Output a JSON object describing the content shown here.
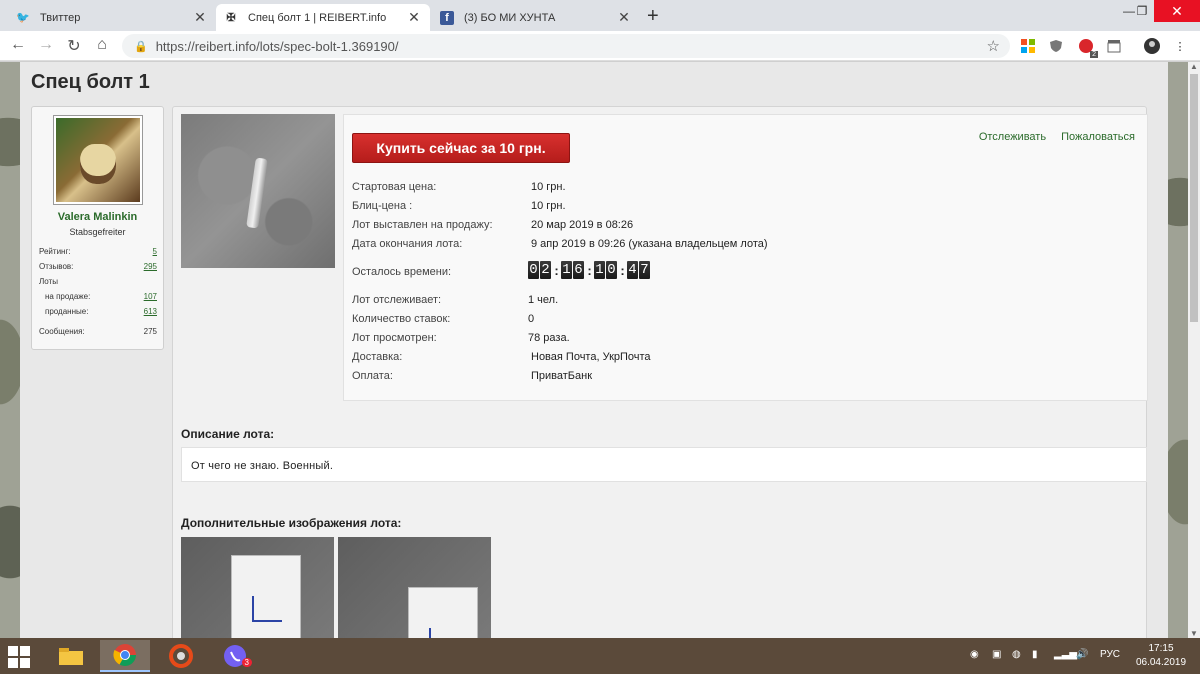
{
  "browser": {
    "tabs": [
      {
        "title": "Твиттер",
        "favicon": "twitter-icon",
        "color": "#1da1f2"
      },
      {
        "title": "Спец болт 1 | REIBERT.info",
        "favicon": "cross-icon",
        "active": true
      },
      {
        "title": "(3) БО МИ ХУНТА",
        "favicon": "facebook-icon",
        "color": "#3b5998"
      }
    ],
    "url": "https://reibert.info/lots/spec-bolt-1.369190/",
    "extension_badge": "2"
  },
  "page": {
    "title": "Спец болт 1"
  },
  "user": {
    "name": "Valera Malinkin",
    "rank": "Stabsgefreiter",
    "stats": [
      {
        "label": "Рейтинг:",
        "value": "5",
        "link": true
      },
      {
        "label": "Отзывов:",
        "value": "295",
        "link": true
      },
      {
        "label": "Лоты",
        "value": ""
      },
      {
        "label": "на продаже:",
        "value": "107",
        "link": true
      },
      {
        "label": "проданные:",
        "value": "613",
        "link": true
      },
      {
        "label": "Сообщения:",
        "value": "275",
        "link": false
      }
    ]
  },
  "lot": {
    "buy_label": "Купить сейчас за 10 грн.",
    "watch_label": "Отслеживать",
    "report_label": "Пожаловаться",
    "rows": [
      {
        "label": "Стартовая цена:",
        "value": "10 грн."
      },
      {
        "label": "Блиц-цена :",
        "value": "10 грн."
      },
      {
        "label": "Лот выставлен на продажу:",
        "value": "20 мар 2019 в 08:26"
      },
      {
        "label": "Дата окончания лота:",
        "value": "9 апр 2019 в 09:26 (указана владельцем лота)"
      }
    ],
    "time_left_label": "Осталось времени:",
    "time_left": {
      "d": "02",
      "h": "16",
      "m": "10",
      "s": "47"
    },
    "rows2": [
      {
        "label": "Лот отслеживает:",
        "value": "1 чел."
      },
      {
        "label": "Количество ставок:",
        "value": "0"
      },
      {
        "label": "Лот просмотрен:",
        "value": "78 раза."
      },
      {
        "label": "Доставка:",
        "value": "Новая Почта, УкрПочта"
      },
      {
        "label": "Оплата:",
        "value": "ПриватБанк"
      }
    ],
    "description_title": "Описание лота:",
    "description": "От чего не знаю. Военный.",
    "extra_images_title": "Дополнительные изображения лота:"
  },
  "taskbar": {
    "lang": "РУС",
    "time": "17:15",
    "date": "06.04.2019",
    "viber_badge": "3"
  }
}
